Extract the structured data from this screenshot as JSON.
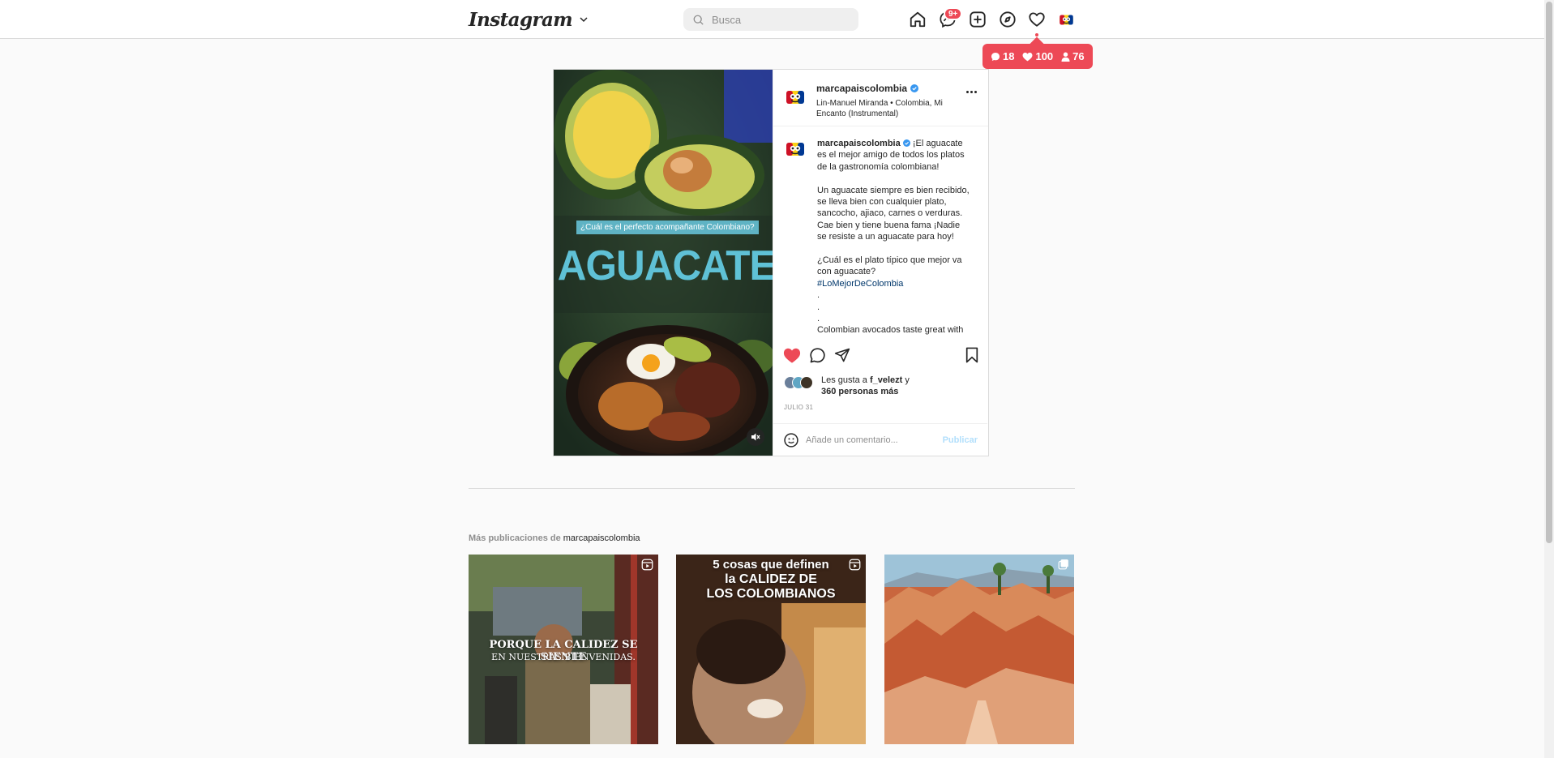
{
  "nav": {
    "logo": "Instagram",
    "search_placeholder": "Busca",
    "dm_badge": "9+"
  },
  "notifications": {
    "comments": "18",
    "likes": "100",
    "followers": "76"
  },
  "post": {
    "username": "marcapaiscolombia",
    "audio": "Lin-Manuel Miranda • Colombia, Mi Encanto (Instrumental)",
    "media": {
      "tag": "¿Cuál es el perfecto acompañante Colombiano?",
      "title": "AGUACATE"
    },
    "caption": {
      "intro": "¡El aguacate es el mejor amigo de todos los platos de la gastronomía colombiana!",
      "lines": [
        "",
        "Un aguacate siempre es bien recibido, se lleva bien con cualquier plato, sancocho, ajiaco, carnes o verduras. Cae bien y tiene buena fama ¡Nadie se resiste a un aguacate para hoy!",
        "",
        "¿Cuál es el plato típico que mejor va con aguacate?"
      ],
      "hashtag": "#LoMejorDeColombia",
      "dots": [
        ".",
        ".",
        "."
      ],
      "tail": "Colombian avocados taste great with"
    },
    "likes": {
      "prefix": "Les gusta a",
      "user": "f_velezt",
      "suffix": "y",
      "count_text": "360 personas más"
    },
    "date": "JULIO 31",
    "comment_placeholder": "Añade un comentario...",
    "publish_label": "Publicar"
  },
  "more_posts": {
    "title_prefix": "Más publicaciones de",
    "title_user": "marcapaiscolombia",
    "items": [
      {
        "line1": "PORQUE LA CALIDEZ SE SIENTE",
        "line2": "EN NUESTRAS BIENVENIDAS."
      },
      {
        "line1": "5 cosas que definen",
        "line2": "la CALIDEZ DE",
        "line3": "LOS COLOMBIANOS"
      },
      {
        "line1": ""
      }
    ]
  },
  "colors": {
    "accent_red": "#ed4956",
    "link_blue": "#00376b",
    "verified_blue": "#3897f0",
    "publish_disabled": "#b2dffc"
  }
}
